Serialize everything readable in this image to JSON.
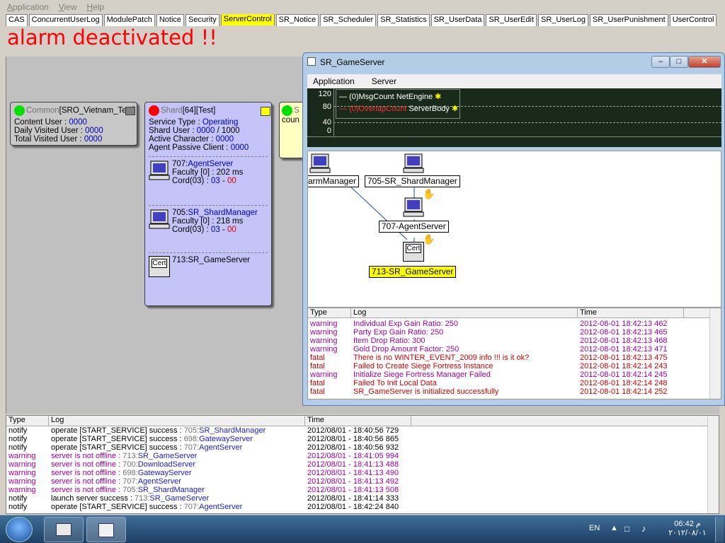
{
  "menu": [
    "Application",
    "View",
    "Help"
  ],
  "tabs": [
    "CAS",
    "ConcurrentUserLog",
    "ModulePatch",
    "Notice",
    "Security",
    "ServerControl",
    "SR_Notice",
    "SR_Scheduler",
    "SR_Statistics",
    "SR_UserData",
    "SR_UserEdit",
    "SR_UserLog",
    "SR_UserPunishment",
    "UserControl"
  ],
  "active_tab": "ServerControl",
  "alarm_text": "alarm deactivated !!",
  "common_card": {
    "title_prefix": "Common",
    "title_name": "[SRO_Vietnam_Test]",
    "lines": [
      {
        "label": "Content User :",
        "value": "0000"
      },
      {
        "label": "Daily Visited User :",
        "value": "0000"
      },
      {
        "label": "Total Visited User :",
        "value": "0000"
      }
    ]
  },
  "shard_card": {
    "title_prefix": "Shard",
    "title_id": "[64]",
    "title_name": "[Test]",
    "service_type_label": "Service Type :",
    "service_type_value": "Operating",
    "shard_user_label": "Shard User :",
    "shard_user_value": "0000",
    "shard_user_max": "/ 1000",
    "active_char_label": "Active Character :",
    "active_char_value": "0000",
    "agent_passive_label": "Agent Passive Client :",
    "agent_passive_value": "0000",
    "servers": [
      {
        "id": "707:",
        "name": "AgentServer",
        "faculty": "Faculty [0] : 202 ms",
        "cord_label": "Cord(03) :",
        "cord_a": "03",
        "cord_sep": " - ",
        "cord_b": "00"
      },
      {
        "id": "705:",
        "name": "SR_ShardManager",
        "faculty": "Faculty [0] : 218 ms",
        "cord_label": "Cord(03) :",
        "cord_a": "03",
        "cord_sep": " - ",
        "cord_b": "00"
      },
      {
        "id": "713:",
        "name": "SR_GameServer",
        "cert": "Cert"
      }
    ]
  },
  "third_card": {
    "title": "S",
    "line": "coun"
  },
  "gameserver_window": {
    "title": "SR_GameServer",
    "menu": [
      "Application",
      "Server"
    ],
    "chart": {
      "y_ticks": [
        "120",
        "80",
        "40",
        "0"
      ],
      "legend": [
        {
          "prefix": "(0)",
          "name": "MsgCount",
          "engine": "NetEngine",
          "color": "#ffffff"
        },
        {
          "prefix": "(0)",
          "name": "OverlapCount",
          "engine": "ServerBody",
          "color": "#ff3030"
        }
      ]
    },
    "nodes": {
      "farm_manager": "armManager",
      "shard_manager": "705-SR_ShardManager",
      "agent_server": "707-AgentServer",
      "game_server": "713-SR_GameServer",
      "cert": "Cert"
    },
    "log_headers": [
      "Type",
      "Log",
      "Time"
    ],
    "log_rows": [
      {
        "type": "warning",
        "log": "Individual Exp Gain Ratio: 250",
        "time": "2012-08-01 18:42:13 462"
      },
      {
        "type": "warning",
        "log": "Party Exp Gain Ratio: 250",
        "time": "2012-08-01 18:42:13 465"
      },
      {
        "type": "warning",
        "log": "Item Drop Ratio: 300",
        "time": "2012-08-01 18:42:13 468"
      },
      {
        "type": "warning",
        "log": "Gold Drop Amount Factor: 250",
        "time": "2012-08-01 18:42:13 471"
      },
      {
        "type": "fatal",
        "log": "There is no WINTER_EVENT_2009 info !!! is it ok?",
        "time": "2012-08-01 18:42:13 475"
      },
      {
        "type": "fatal",
        "log": "Failed to Create Siege Fortress Instance",
        "time": "2012-08-01 18:42:14 243"
      },
      {
        "type": "warning",
        "log": "Initialize Siege Fortress Manager Failed",
        "time": "2012-08-01 18:42:14 245"
      },
      {
        "type": "fatal",
        "log": "Failed To Init Local Data",
        "time": "2012-08-01 18:42:14 248"
      },
      {
        "type": "fatal",
        "log": "SR_GameServer is initialized successfully",
        "time": "2012-08-01 18:42:14 252"
      }
    ]
  },
  "bottom_log": {
    "headers": [
      "Type",
      "Log",
      "Time"
    ],
    "rows": [
      {
        "type": "notify",
        "text": "operate [START_SERVICE] success : ",
        "id": "705:",
        "name": "SR_ShardManager",
        "time": "2012/08/01 - 18:40:56 729"
      },
      {
        "type": "notify",
        "text": "operate [START_SERVICE] success : ",
        "id": "698:",
        "name": "GatewayServer",
        "time": "2012/08/01 - 18:40:56 865"
      },
      {
        "type": "notify",
        "text": "operate [START_SERVICE] success : ",
        "id": "707:",
        "name": "AgentServer",
        "time": "2012/08/01 - 18:40:56 932"
      },
      {
        "type": "warning",
        "text": "server is not offline : ",
        "id": "713:",
        "name": "SR_GameServer",
        "time": "2012/08/01 - 18:41:05 994"
      },
      {
        "type": "warning",
        "text": "server is not offline : ",
        "id": "700:",
        "name": "DownloadServer",
        "time": "2012/08/01 - 18:41:13 488"
      },
      {
        "type": "warning",
        "text": "server is not offline : ",
        "id": "698:",
        "name": "GatewayServer",
        "time": "2012/08/01 - 18:41:13 490"
      },
      {
        "type": "warning",
        "text": "server is not offline : ",
        "id": "707:",
        "name": "AgentServer",
        "time": "2012/08/01 - 18:41:13 492"
      },
      {
        "type": "warning",
        "text": "server is not offline : ",
        "id": "705:",
        "name": "SR_ShardManager",
        "time": "2012/08/01 - 18:41:13 508"
      },
      {
        "type": "notify",
        "text": "launch server success : ",
        "id": "713:",
        "name": "SR_GameServer",
        "time": "2012/08/01 - 18:41:14 333"
      },
      {
        "type": "notify",
        "text": "operate [START_SERVICE] success : ",
        "id": "707:",
        "name": "AgentServer",
        "time": "2012/08/01 - 18:42:24 840"
      }
    ]
  },
  "taskbar": {
    "lang": "EN",
    "time": "06:42 م",
    "date": "٢٠١٢/٠٨/٠١"
  },
  "colors": {
    "warning": "#a000a0",
    "fatal": "#d00000",
    "notify": "#000000",
    "server_name": "#2020c0"
  }
}
